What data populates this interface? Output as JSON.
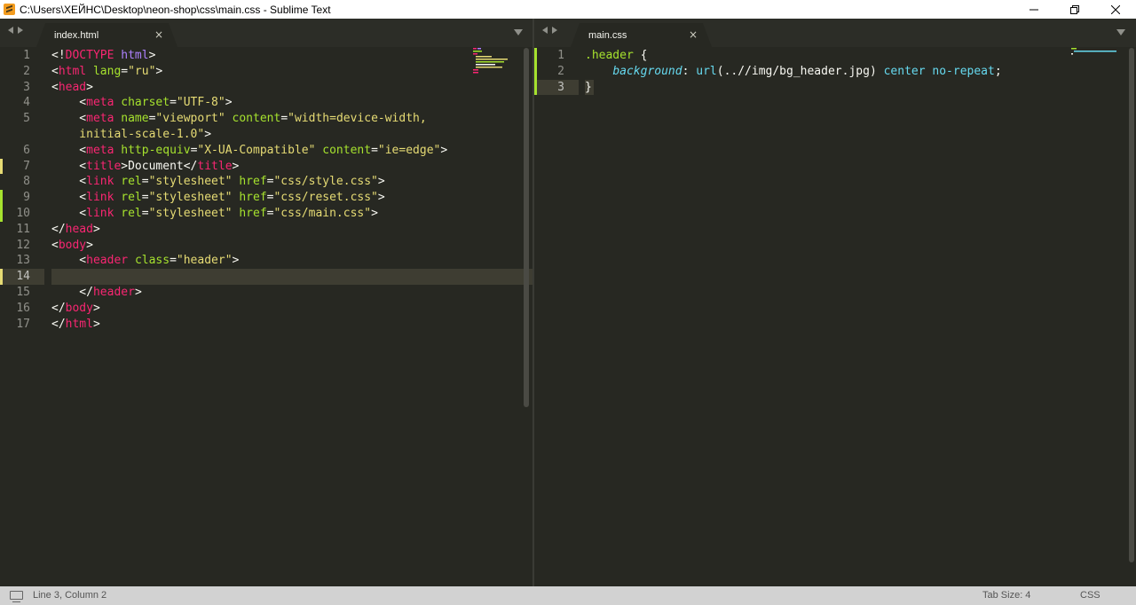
{
  "window": {
    "title": "C:\\Users\\ХЕЙНС\\Desktop\\neon-shop\\css\\main.css - Sublime Text",
    "app_icon": "sublime-text-icon",
    "controls": [
      "minimize-icon",
      "restore-icon",
      "close-icon"
    ]
  },
  "left_pane": {
    "tab": {
      "label": "index.html",
      "close": "×"
    },
    "lines": [
      {
        "n": "1",
        "marker": "",
        "segments": [
          [
            "pun",
            "<!"
          ],
          [
            "tag",
            "DOCTYPE"
          ],
          [
            "pun",
            " "
          ],
          [
            "doctype",
            "html"
          ],
          [
            "pun",
            ">"
          ]
        ]
      },
      {
        "n": "2",
        "marker": "",
        "segments": [
          [
            "pun",
            "<"
          ],
          [
            "tag",
            "html"
          ],
          [
            "pun",
            " "
          ],
          [
            "attr",
            "lang"
          ],
          [
            "pun",
            "="
          ],
          [
            "str",
            "\"ru\""
          ],
          [
            "pun",
            ">"
          ]
        ]
      },
      {
        "n": "3",
        "marker": "",
        "segments": [
          [
            "pun",
            "<"
          ],
          [
            "tag",
            "head"
          ],
          [
            "pun",
            ">"
          ]
        ]
      },
      {
        "n": "4",
        "marker": "",
        "segments": [
          [
            "pun",
            "    <"
          ],
          [
            "tag",
            "meta"
          ],
          [
            "pun",
            " "
          ],
          [
            "attr",
            "charset"
          ],
          [
            "pun",
            "="
          ],
          [
            "str",
            "\"UTF-8\""
          ],
          [
            "pun",
            ">"
          ]
        ]
      },
      {
        "n": "5",
        "marker": "",
        "segments": [
          [
            "pun",
            "    <"
          ],
          [
            "tag",
            "meta"
          ],
          [
            "pun",
            " "
          ],
          [
            "attr",
            "name"
          ],
          [
            "pun",
            "="
          ],
          [
            "str",
            "\"viewport\""
          ],
          [
            "pun",
            " "
          ],
          [
            "attr",
            "content"
          ],
          [
            "pun",
            "="
          ],
          [
            "str",
            "\"width=device-width,"
          ]
        ]
      },
      {
        "n": "",
        "marker": "",
        "segments": [
          [
            "str",
            "    initial-scale-1.0\""
          ],
          [
            "pun",
            ">"
          ]
        ]
      },
      {
        "n": "6",
        "marker": "",
        "segments": [
          [
            "pun",
            "    <"
          ],
          [
            "tag",
            "meta"
          ],
          [
            "pun",
            " "
          ],
          [
            "attr",
            "http-equiv"
          ],
          [
            "pun",
            "="
          ],
          [
            "str",
            "\"X-UA-Compatible\""
          ],
          [
            "pun",
            " "
          ],
          [
            "attr",
            "content"
          ],
          [
            "pun",
            "="
          ],
          [
            "str",
            "\"ie=edge\""
          ],
          [
            "pun",
            ">"
          ]
        ]
      },
      {
        "n": "7",
        "marker": "modified",
        "segments": [
          [
            "pun",
            "    <"
          ],
          [
            "tag",
            "title"
          ],
          [
            "pun",
            ">"
          ],
          [
            "txt",
            "Document"
          ],
          [
            "pun",
            "</"
          ],
          [
            "tag",
            "title"
          ],
          [
            "pun",
            ">"
          ]
        ]
      },
      {
        "n": "8",
        "marker": "",
        "segments": [
          [
            "pun",
            "    <"
          ],
          [
            "tag",
            "link"
          ],
          [
            "pun",
            " "
          ],
          [
            "attr",
            "rel"
          ],
          [
            "pun",
            "="
          ],
          [
            "str",
            "\"stylesheet\""
          ],
          [
            "pun",
            " "
          ],
          [
            "attr",
            "href"
          ],
          [
            "pun",
            "="
          ],
          [
            "str",
            "\"css/style.css\""
          ],
          [
            "pun",
            ">"
          ]
        ]
      },
      {
        "n": "9",
        "marker": "added",
        "segments": [
          [
            "pun",
            "    <"
          ],
          [
            "tag",
            "link"
          ],
          [
            "pun",
            " "
          ],
          [
            "attr",
            "rel"
          ],
          [
            "pun",
            "="
          ],
          [
            "str",
            "\"stylesheet\""
          ],
          [
            "pun",
            " "
          ],
          [
            "attr",
            "href"
          ],
          [
            "pun",
            "="
          ],
          [
            "str",
            "\"css/reset.css\""
          ],
          [
            "pun",
            ">"
          ]
        ]
      },
      {
        "n": "10",
        "marker": "added",
        "segments": [
          [
            "pun",
            "    <"
          ],
          [
            "tag",
            "link"
          ],
          [
            "pun",
            " "
          ],
          [
            "attr",
            "rel"
          ],
          [
            "pun",
            "="
          ],
          [
            "str",
            "\"stylesheet\""
          ],
          [
            "pun",
            " "
          ],
          [
            "attr",
            "href"
          ],
          [
            "pun",
            "="
          ],
          [
            "str",
            "\"css/main.css\""
          ],
          [
            "pun",
            ">"
          ]
        ]
      },
      {
        "n": "11",
        "marker": "",
        "segments": [
          [
            "pun",
            "</"
          ],
          [
            "tag",
            "head"
          ],
          [
            "pun",
            ">"
          ]
        ]
      },
      {
        "n": "12",
        "marker": "",
        "segments": [
          [
            "pun",
            "<"
          ],
          [
            "tag",
            "body"
          ],
          [
            "pun",
            ">"
          ]
        ]
      },
      {
        "n": "13",
        "marker": "",
        "segments": [
          [
            "pun",
            "    <"
          ],
          [
            "tag",
            "header"
          ],
          [
            "pun",
            " "
          ],
          [
            "attr",
            "class"
          ],
          [
            "pun",
            "="
          ],
          [
            "str",
            "\"header\""
          ],
          [
            "pun",
            ">"
          ]
        ]
      },
      {
        "n": "14",
        "marker": "modified",
        "active": true,
        "segments": []
      },
      {
        "n": "15",
        "marker": "",
        "segments": [
          [
            "pun",
            "    </"
          ],
          [
            "tag",
            "header"
          ],
          [
            "pun",
            ">"
          ]
        ]
      },
      {
        "n": "16",
        "marker": "",
        "segments": [
          [
            "pun",
            "</"
          ],
          [
            "tag",
            "body"
          ],
          [
            "pun",
            ">"
          ]
        ]
      },
      {
        "n": "17",
        "marker": "",
        "segments": [
          [
            "pun",
            "</"
          ],
          [
            "tag",
            "html"
          ],
          [
            "pun",
            ">"
          ]
        ]
      }
    ]
  },
  "right_pane": {
    "tab": {
      "label": "main.css",
      "close": "×"
    },
    "lines": [
      {
        "n": "1",
        "marker": "added",
        "segments": [
          [
            "sel",
            ".header"
          ],
          [
            "pun",
            " {"
          ]
        ]
      },
      {
        "n": "2",
        "marker": "added",
        "segments": [
          [
            "pun",
            "    "
          ],
          [
            "prop",
            "background"
          ],
          [
            "pun",
            ": "
          ],
          [
            "fn",
            "url"
          ],
          [
            "pun",
            "("
          ],
          [
            "txt",
            "..//img/bg_header.jpg"
          ],
          [
            "pun",
            ") "
          ],
          [
            "kw",
            "center"
          ],
          [
            "pun",
            " "
          ],
          [
            "kw",
            "no-repeat"
          ],
          [
            "pun",
            ";"
          ]
        ]
      },
      {
        "n": "3",
        "marker": "added",
        "active": true,
        "segments": [
          [
            "pun",
            "}"
          ]
        ]
      }
    ]
  },
  "statusbar": {
    "icon": "panel-toggle-icon",
    "position": "Line 3, Column 2",
    "tab_size": "Tab Size: 4",
    "syntax": "CSS"
  },
  "colors": {
    "background": "#272822",
    "tag": "#f92672",
    "attribute": "#a6e22e",
    "string": "#e6db74",
    "keyword": "#66d9ef",
    "doctype": "#ae81ff"
  }
}
